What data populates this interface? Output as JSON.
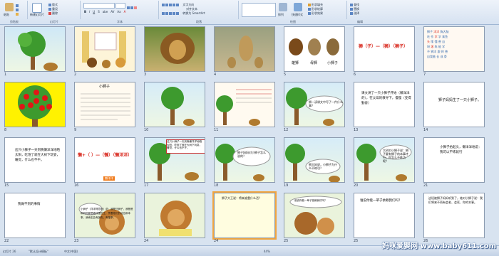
{
  "ribbon": {
    "groups": [
      "剪贴板",
      "幻灯片",
      "字体",
      "段落",
      "绘图",
      "编辑"
    ],
    "buttons": {
      "paste": "粘贴",
      "new_slide": "新建幻灯片",
      "layout": "版式",
      "reset": "重设",
      "delete": "删除",
      "text_direction": "文字方向",
      "align_text": "对齐文本",
      "convert_smartart": "转换为 SmartArt",
      "arrange": "排列",
      "quick_styles": "快速样式",
      "shape_fill": "形状填充",
      "shape_outline": "形状轮廓",
      "shape_effects": "形状效果",
      "find": "查找",
      "replace": "替换",
      "select": "选择"
    }
  },
  "slides": [
    {
      "n": "1",
      "title": ""
    },
    {
      "n": "2",
      "title": ""
    },
    {
      "n": "3",
      "title": ""
    },
    {
      "n": "4",
      "title": ""
    },
    {
      "n": "5",
      "title": "",
      "labels": [
        "雄狮",
        "母狮",
        "小狮子"
      ]
    },
    {
      "n": "6",
      "title": "",
      "text": "狮（子）—（狮）（狮子）"
    },
    {
      "n": "7",
      "title": "",
      "words": [
        "狮子",
        "洋洋",
        "胸大脑",
        "吃",
        "作",
        "学",
        "学",
        "乘鱼",
        "头",
        "嗦",
        "懂",
        "兽",
        "自",
        "呀",
        "滚",
        "练",
        "能",
        "学",
        "不",
        "狮洋",
        "跟",
        "称",
        "兽",
        "自我羞",
        "长",
        "成",
        "骨"
      ]
    },
    {
      "n": "8",
      "title": ""
    },
    {
      "n": "9",
      "title": "小狮子"
    },
    {
      "n": "10",
      "title": ""
    },
    {
      "n": "11",
      "title": ""
    },
    {
      "n": "12",
      "text": "狮一读课文中写了一件什么事？"
    },
    {
      "n": "13",
      "text": "课文讲了一只小狮子开始（懒洋洋的），在父母的教导下，慢慢（变得勤奋）"
    },
    {
      "n": "14",
      "text": "狮子妈妈生了一只小狮子。"
    },
    {
      "n": "15",
      "text": "这只小狮子一天到晚懒洋洋地晒太阳，吃饱了就在大树下玩耍，睡觉，什么也不干。"
    },
    {
      "n": "16",
      "text": "懒+（ ）—（懒）（懒洋洋）",
      "badge": "懒洋洋"
    },
    {
      "n": "17",
      "text": "这只小狮子一天到晚懒洋洋地晒太阳，吃饱了就在大树下玩耍，睡觉，什么也不干。"
    },
    {
      "n": "18",
      "text": "狮子妈妈对小狮子怎么说的？"
    },
    {
      "n": "19",
      "text": "狮大妈说，小狮子为什么不练功？"
    },
    {
      "n": "20",
      "text": "大树对小狮子说：狮子要有狮子的本事才行，你怎么不练功呢？"
    },
    {
      "n": "21",
      "text": "小狮子抬起头，懒洋洋地说：我可以不练就行"
    },
    {
      "n": "22",
      "text": "我做不到的事情"
    },
    {
      "n": "23",
      "text": "小狮子（洋洋得意地）说：我是只狮子，我爸爸和妈妈都是森林里的王，凭着他们的地位和本事，我肯定会有饭吃，有福享。"
    },
    {
      "n": "24",
      "text": "狮子大王说：将来谁靠什么活？"
    },
    {
      "n": "25",
      "text": "谁说你能一辈子依赖我们吗？"
    },
    {
      "n": "26",
      "text": "这话被狮子妈妈听到了，她对小狮子说：我们将来不再有会老、会死、你的本事。"
    }
  ],
  "colors": {
    "red": "#d8271c",
    "tree_green": "#3d9a2e",
    "apple_red": "#e01616",
    "sky": "#c7e3f6",
    "lion": "#b07a2e",
    "orange_tag": "#f07a1a"
  },
  "status": {
    "slide_info": "幻灯片 26",
    "theme": "\"默认设计模板\"",
    "lang": "中文(中国)",
    "zoom": "44%"
  },
  "watermark": "妈咪爱婴网 www.baby611.com"
}
